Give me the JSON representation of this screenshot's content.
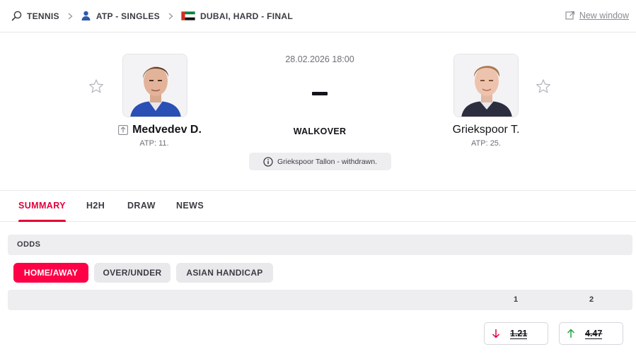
{
  "breadcrumb": {
    "sport": "TENNIS",
    "category": "ATP - SINGLES",
    "tournament": "DUBAI, HARD - FINAL"
  },
  "new_window_label": "New window",
  "match": {
    "datetime": "28.02.2026 18:00",
    "score": "-",
    "status": "WALKOVER",
    "info": "Griekspoor Tallon - withdrawn.",
    "home": {
      "name": "Medvedev D.",
      "rank": "ATP: 11."
    },
    "away": {
      "name": "Griekspoor T.",
      "rank": "ATP: 25."
    }
  },
  "tabs": [
    {
      "label": "SUMMARY",
      "active": true
    },
    {
      "label": "H2H",
      "active": false
    },
    {
      "label": "DRAW",
      "active": false
    },
    {
      "label": "NEWS",
      "active": false
    }
  ],
  "odds": {
    "header": "ODDS",
    "markets": [
      {
        "label": "HOME/AWAY",
        "active": true
      },
      {
        "label": "OVER/UNDER",
        "active": false
      },
      {
        "label": "ASIAN HANDICAP",
        "active": false
      }
    ],
    "columns": [
      "1",
      "2"
    ],
    "values": [
      {
        "value": "1.21",
        "trend": "down",
        "trend_color": "#e2003b"
      },
      {
        "value": "4.47",
        "trend": "up",
        "trend_color": "#1fa73a"
      }
    ]
  },
  "colors": {
    "accent": "#e2003b",
    "pill_active": "#ff0046"
  }
}
